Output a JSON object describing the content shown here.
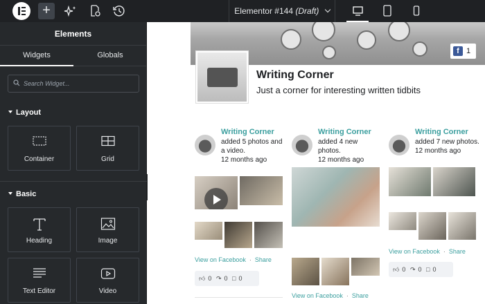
{
  "topbar": {
    "add_icon": "plus-icon",
    "ai_icon": "sparkle-icon",
    "page_settings_icon": "page-settings-icon",
    "history_icon": "history-icon",
    "doc_title": "Elementor #144",
    "doc_status": "(Draft)",
    "devices": [
      "desktop-icon",
      "tablet-icon",
      "mobile-icon"
    ],
    "active_device": "desktop"
  },
  "panel": {
    "title": "Elements",
    "tabs": [
      {
        "label": "Widgets",
        "active": true
      },
      {
        "label": "Globals",
        "active": false
      }
    ],
    "search": {
      "placeholder": "Search Widget..."
    },
    "sections": [
      {
        "title": "Layout",
        "widgets": [
          {
            "label": "Container",
            "icon": "container-icon"
          },
          {
            "label": "Grid",
            "icon": "grid-icon"
          }
        ]
      },
      {
        "title": "Basic",
        "widgets": [
          {
            "label": "Heading",
            "icon": "heading-icon"
          },
          {
            "label": "Image",
            "icon": "image-icon"
          },
          {
            "label": "Text Editor",
            "icon": "text-editor-icon"
          },
          {
            "label": "Video",
            "icon": "video-icon"
          }
        ]
      }
    ]
  },
  "feed": {
    "badge_count": "1",
    "page_name": "Writing Corner",
    "page_description": "Just a corner for interesting written tidbits",
    "posts": [
      {
        "author": "Writing Corner",
        "action_line1": "added 5 photos and",
        "action_line2": "a video.",
        "time": "12 months ago",
        "view_link": "View on Facebook",
        "share": "Share",
        "likes": "0",
        "shares": "0",
        "comments": "0"
      },
      {
        "author": "Writing Corner",
        "action_line1": "added 4 new photos.",
        "time": "12 months ago",
        "view_link": "View on Facebook",
        "share": "Share"
      },
      {
        "author": "Writing Corner",
        "action_line1": "added 7 new photos.",
        "time": "12 months ago",
        "view_link": "View on Facebook",
        "share": "Share",
        "likes": "0",
        "shares": "0",
        "comments": "0"
      }
    ]
  },
  "colors": {
    "panel_bg": "#26292c",
    "topbar_bg": "#1f2124",
    "link": "#3a9e9e",
    "facebook": "#3b5998"
  }
}
